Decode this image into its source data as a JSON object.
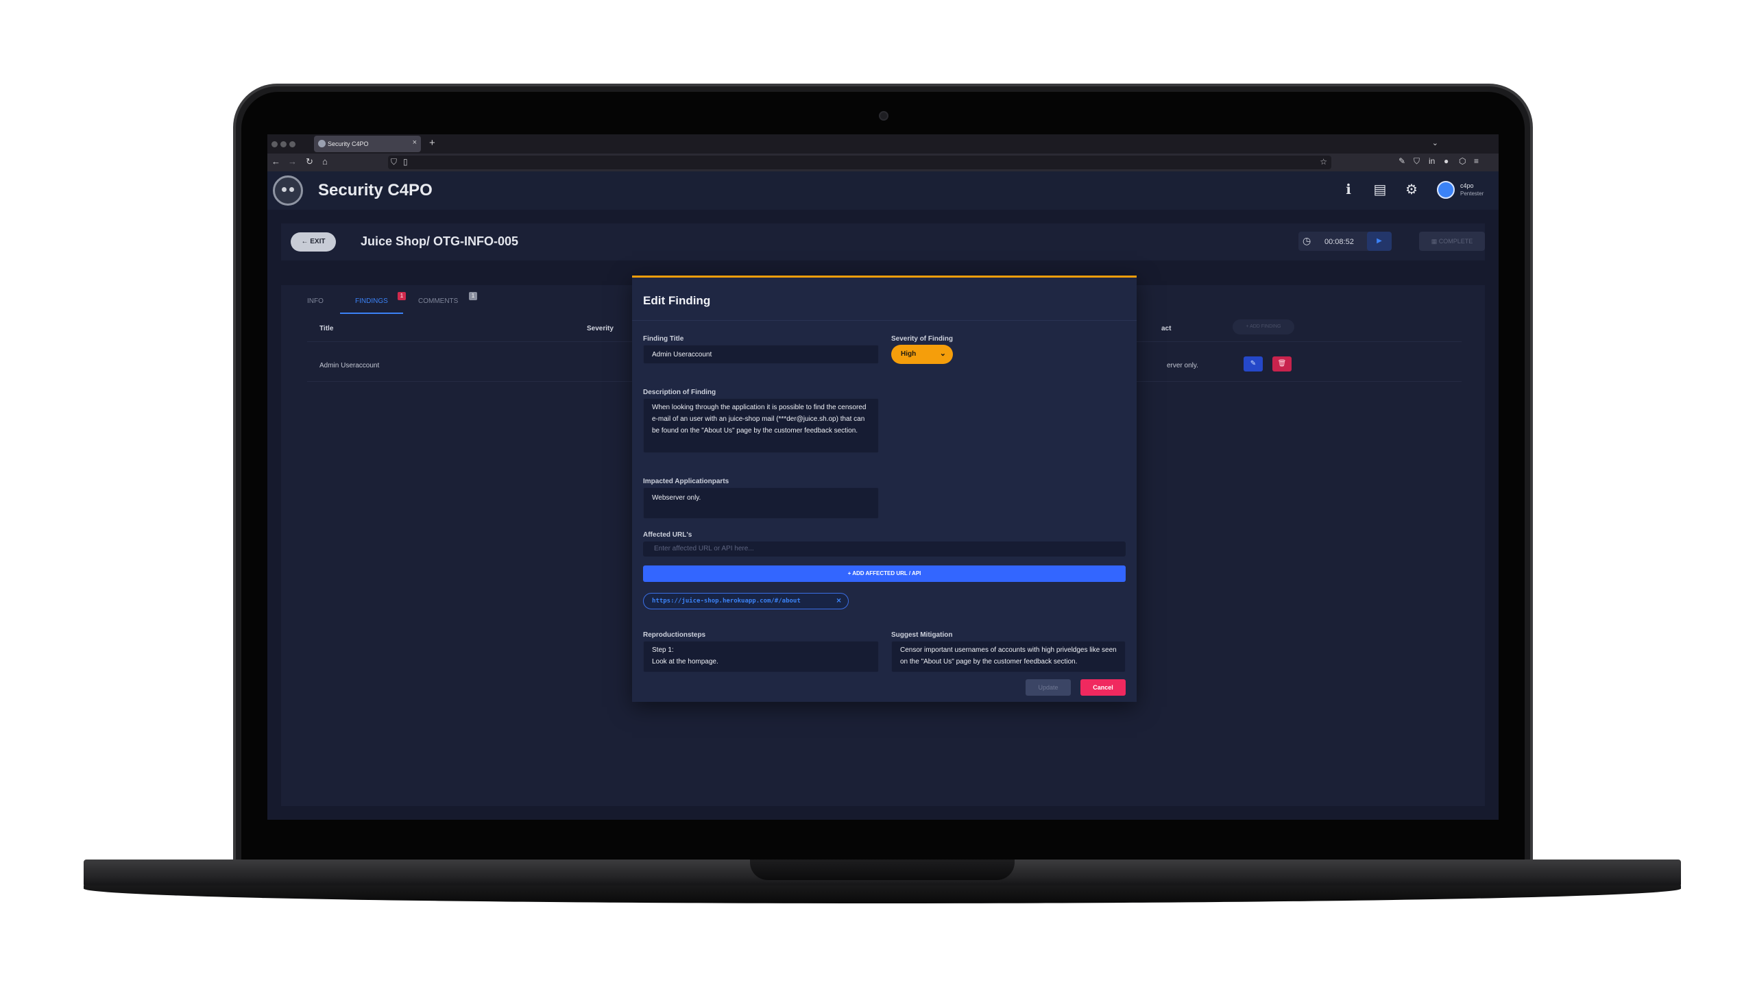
{
  "browser": {
    "tab_title": "Security C4PO",
    "tab_close": "×",
    "new_tab": "+",
    "tabs_menu": "⌄",
    "back": "←",
    "forward": "→",
    "reload": "↻",
    "home": "⌂",
    "bookmark": "☆",
    "shield": "⛉",
    "page_icon": "▯",
    "toolbar": [
      "✎",
      "⛉",
      "in",
      "●",
      "⬡",
      "≡"
    ]
  },
  "app": {
    "title": "Security C4PO",
    "user_name": "c4po",
    "user_role": "Pentester",
    "info_icon": "ℹ",
    "doc_icon": "▤",
    "settings_icon": "⚙"
  },
  "page": {
    "exit_label": "EXIT",
    "exit_arrow": "←",
    "title": "Juice Shop/ OTG-INFO-005",
    "timer_icon": "◷",
    "timer": "00:08:52",
    "play": "▶",
    "complete_label": "COMPLETE",
    "complete_icon": "▦"
  },
  "tabs": [
    {
      "label": "INFO"
    },
    {
      "label": "FINDINGS",
      "badge": "1"
    },
    {
      "label": "COMMENTS",
      "badge": "1"
    }
  ],
  "table": {
    "headers": [
      "Title",
      "Severity",
      "act"
    ],
    "rows": [
      {
        "title": "Admin Useraccount",
        "impact": "erver only."
      }
    ],
    "add_finding": "+ ADD FINDING",
    "edit_icon": "✎",
    "delete_icon": "🗑"
  },
  "modal": {
    "title": "Edit Finding",
    "finding_title_label": "Finding Title",
    "finding_title": "Admin Useraccount",
    "severity_label": "Severity of Finding",
    "severity": "High",
    "severity_chevron": "⌄",
    "description_label": "Description of Finding",
    "description": "When looking through the application it is possible to find the censored e-mail of an user with an juice-shop mail (***der@juice.sh.op) that can be found on the \"About Us\" page by the customer feedback section.",
    "impact_label": "Impacted Applicationparts",
    "impact": "Webserver only.",
    "urls_label": "Affected URL's",
    "url_placeholder": "Enter affected URL or API here...",
    "add_url_label": "+ ADD AFFECTED URL / API",
    "url_chip": "https://juice-shop.herokuapp.com/#/about",
    "chip_close": "×",
    "repro_label": "Reproductionsteps",
    "repro": "Step 1:\nLook at the hompage.",
    "mitigation_label": "Suggest Mitigation",
    "mitigation": "Censor important usernames of accounts with high priveldges like seen on the \"About Us\" page by the customer feedback section.",
    "update_label": "Update",
    "cancel_label": "Cancel"
  },
  "colors": {
    "accent": "#3366ff",
    "severity_high": "#f59e0b",
    "danger": "#f0295f",
    "modal_bg": "#1f2743"
  }
}
